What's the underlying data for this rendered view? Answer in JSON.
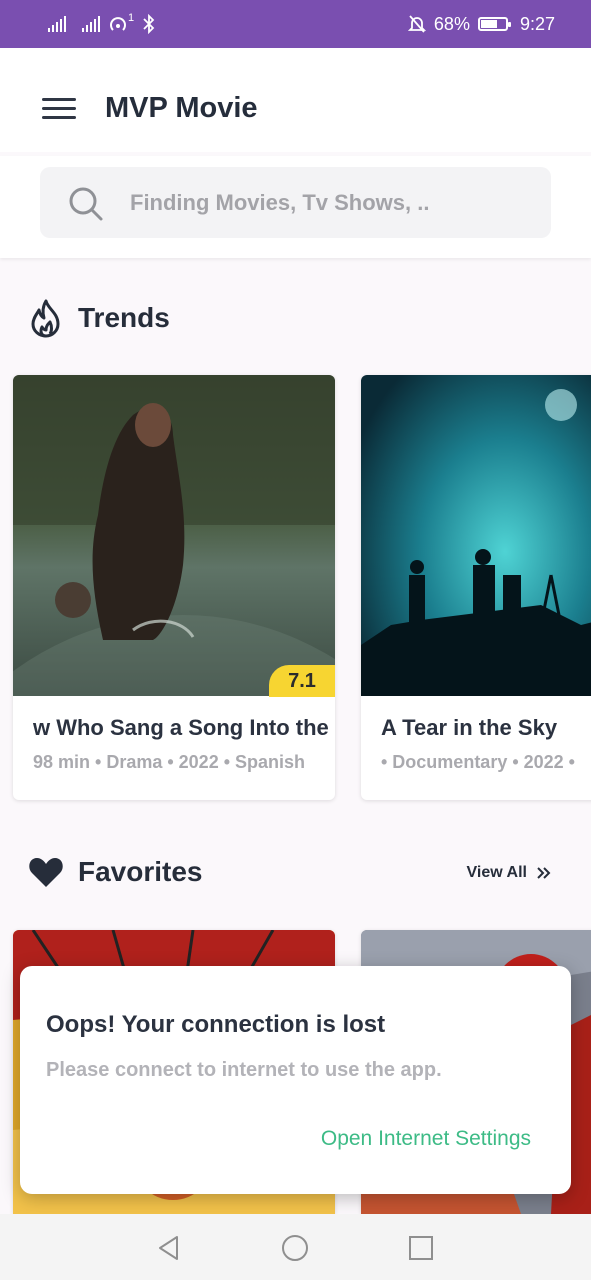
{
  "status_bar": {
    "battery": "68%",
    "time": "9:27",
    "sim_badge": "1",
    "icons": [
      "signal-icon",
      "signal-icon",
      "hotspot-icon",
      "bluetooth-icon",
      "mute-icon",
      "battery-icon"
    ]
  },
  "header": {
    "title": "MVP Movie",
    "menu_icon": "hamburger-menu-icon"
  },
  "search": {
    "placeholder": "Finding Movies, Tv Shows, ..",
    "icon": "search-icon"
  },
  "trends": {
    "title": "Trends",
    "icon": "flame-icon",
    "cards": [
      {
        "title": "w Who Sang a Song Into the",
        "meta": "98 min • Drama • 2022 • Spanish",
        "rating": "7.1"
      },
      {
        "title": "A Tear in the Sky",
        "meta": "• Documentary • 2022 • "
      }
    ]
  },
  "favorites": {
    "title": "Favorites",
    "icon": "heart-icon",
    "view_all": "View All"
  },
  "dialog": {
    "title": "Oops! Your connection is lost",
    "message": "Please connect to internet to use the app.",
    "action": "Open Internet Settings"
  },
  "colors": {
    "status_bar": "#7a4fb0",
    "accent_green": "#3dbb86",
    "rating_yellow": "#f7d531"
  }
}
